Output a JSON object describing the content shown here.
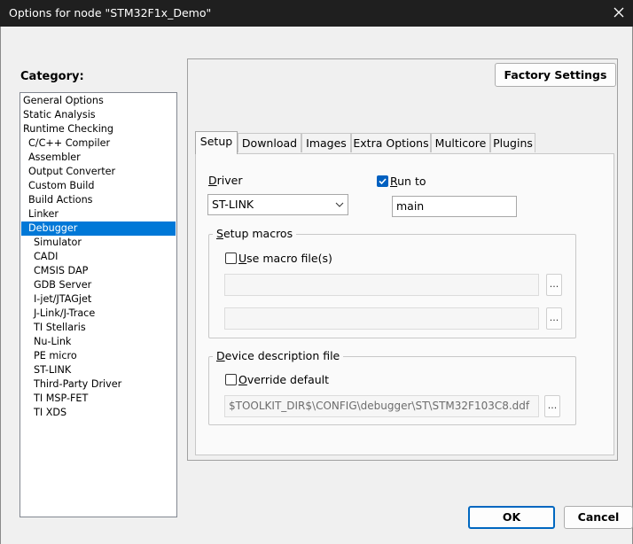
{
  "window": {
    "title": "Options for node \"STM32F1x_Demo\""
  },
  "category": {
    "label": "Category:",
    "selected_index": 9,
    "items": [
      {
        "label": "General Options",
        "indent": 0
      },
      {
        "label": "Static Analysis",
        "indent": 0
      },
      {
        "label": "Runtime Checking",
        "indent": 0
      },
      {
        "label": "C/C++ Compiler",
        "indent": 1
      },
      {
        "label": "Assembler",
        "indent": 1
      },
      {
        "label": "Output Converter",
        "indent": 1
      },
      {
        "label": "Custom Build",
        "indent": 1
      },
      {
        "label": "Build Actions",
        "indent": 1
      },
      {
        "label": "Linker",
        "indent": 1
      },
      {
        "label": "Debugger",
        "indent": 1
      },
      {
        "label": "Simulator",
        "indent": 2
      },
      {
        "label": "CADI",
        "indent": 2
      },
      {
        "label": "CMSIS DAP",
        "indent": 2
      },
      {
        "label": "GDB Server",
        "indent": 2
      },
      {
        "label": "I-jet/JTAGjet",
        "indent": 2
      },
      {
        "label": "J-Link/J-Trace",
        "indent": 2
      },
      {
        "label": "TI Stellaris",
        "indent": 2
      },
      {
        "label": "Nu-Link",
        "indent": 2
      },
      {
        "label": "PE micro",
        "indent": 2
      },
      {
        "label": "ST-LINK",
        "indent": 2
      },
      {
        "label": "Third-Party Driver",
        "indent": 2
      },
      {
        "label": "TI MSP-FET",
        "indent": 2
      },
      {
        "label": "TI XDS",
        "indent": 2
      }
    ]
  },
  "factory_settings_label": "Factory Settings",
  "tabs": [
    {
      "label": "Setup",
      "active": true
    },
    {
      "label": "Download",
      "active": false
    },
    {
      "label": "Images",
      "active": false
    },
    {
      "label": "Extra Options",
      "active": false
    },
    {
      "label": "Multicore",
      "active": false
    },
    {
      "label": "Plugins",
      "active": false
    }
  ],
  "setup": {
    "driver": {
      "label_first": "D",
      "label_rest": "river",
      "value": "ST-LINK"
    },
    "run_to": {
      "label_first": "R",
      "label_rest": "un to",
      "checked": true,
      "value": "main"
    },
    "setup_macros": {
      "title_first": "S",
      "title_rest": "etup macros",
      "use_macro_first": "U",
      "use_macro_rest": "se macro file(s)",
      "use_macro_checked": false,
      "file1": "",
      "file2": ""
    },
    "device_description": {
      "title_first": "D",
      "title_rest": "evice description file",
      "override_first": "O",
      "override_rest": "verride default",
      "override_checked": false,
      "path": "$TOOLKIT_DIR$\\CONFIG\\debugger\\ST\\STM32F103C8.ddf"
    },
    "browse_label": "..."
  },
  "buttons": {
    "ok": "OK",
    "cancel": "Cancel"
  }
}
